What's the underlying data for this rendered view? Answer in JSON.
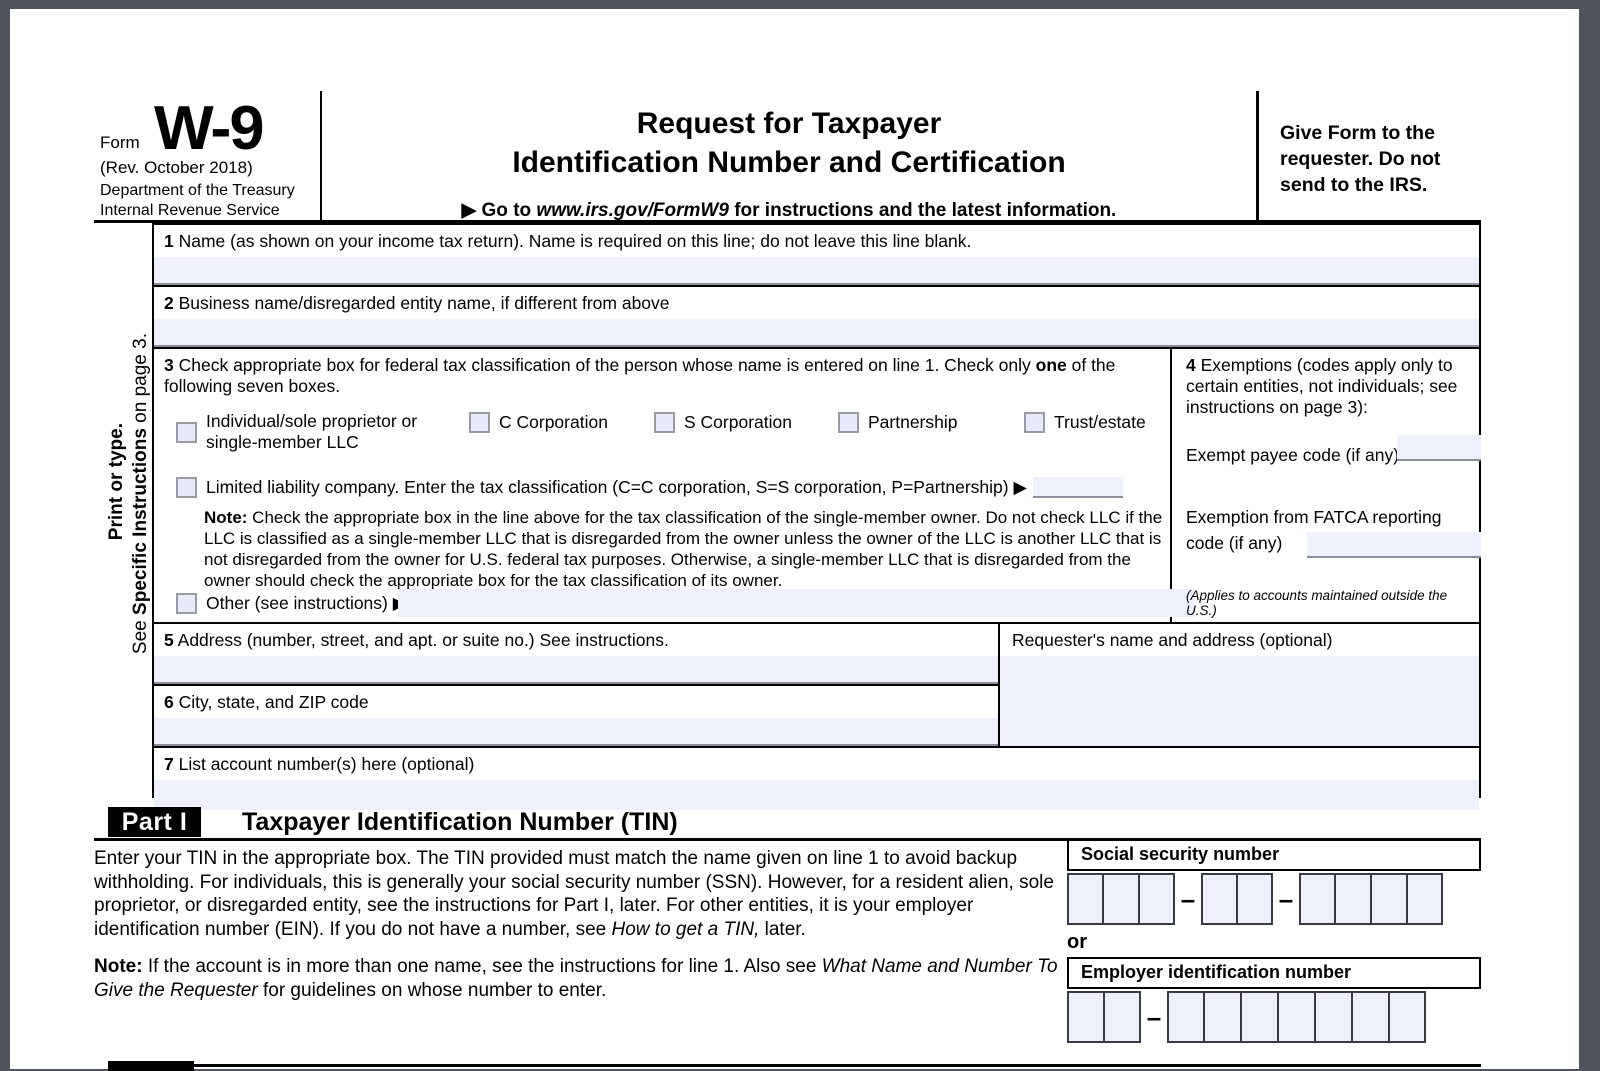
{
  "form": {
    "form_word": "Form",
    "form_number": "W-9",
    "revision": "(Rev. October 2018)",
    "department_line1": "Department of the Treasury",
    "department_line2": "Internal Revenue Service",
    "title_line1": "Request for Taxpayer",
    "title_line2": "Identification Number and Certification",
    "goto_prefix": "▶ Go to ",
    "goto_url": "www.irs.gov/FormW9",
    "goto_suffix": " for instructions and the latest information.",
    "give_form_line1": "Give Form to the",
    "give_form_line2": "requester. Do not",
    "give_form_line3": "send to the IRS."
  },
  "sidebar": {
    "print_or_type": "Print or type.",
    "see_instructions_prefix": "See ",
    "see_instructions_bold": "Specific Instructions",
    "see_instructions_suffix": " on page 3."
  },
  "line1": {
    "number": "1",
    "label": "Name (as shown on your income tax return). Name is required on this line; do not leave this line blank.",
    "value": ""
  },
  "line2": {
    "number": "2",
    "label": "Business name/disregarded entity name, if different from above",
    "value": ""
  },
  "line3": {
    "number": "3",
    "label_part1": "Check appropriate box for federal tax classification of the person whose name is entered on line 1. Check only ",
    "label_bold": "one",
    "label_part2": " of the following seven boxes.",
    "checkboxes": [
      {
        "id": "individual",
        "label_line1": "Individual/sole proprietor or",
        "label_line2": "single-member LLC",
        "checked": false
      },
      {
        "id": "c-corporation",
        "label": "C Corporation",
        "checked": false
      },
      {
        "id": "s-corporation",
        "label": "S Corporation",
        "checked": false
      },
      {
        "id": "partnership",
        "label": "Partnership",
        "checked": false
      },
      {
        "id": "trust-estate",
        "label": "Trust/estate",
        "checked": false
      }
    ],
    "llc": {
      "label": "Limited liability company. Enter the tax classification (C=C corporation, S=S corporation, P=Partnership) ▶",
      "value": "",
      "checked": false
    },
    "note_bold": "Note:",
    "note_text": " Check the appropriate box in the line above for the tax classification of the single-member owner.  Do not check LLC if the LLC is classified as a single-member LLC that is disregarded from the owner unless the owner of the LLC is another LLC that is not disregarded from the owner for U.S. federal tax purposes. Otherwise, a single-member LLC that is disregarded from the owner should check the appropriate box for the tax classification of its owner.",
    "other": {
      "label": "Other (see instructions) ▶",
      "value": "",
      "checked": false
    }
  },
  "line4": {
    "number": "4",
    "label": "Exemptions (codes apply only to certain entities, not individuals; see instructions on page 3):",
    "exempt_payee_label": "Exempt payee code (if any)",
    "exempt_payee_value": "",
    "fatca_label_line1": "Exemption from FATCA reporting",
    "fatca_label_line2": "code (if any)",
    "fatca_value": "",
    "footnote": "(Applies to accounts maintained outside the U.S.)"
  },
  "line5": {
    "number": "5",
    "label": "Address (number, street, and apt. or suite no.) See instructions.",
    "value": ""
  },
  "line6": {
    "number": "6",
    "label": "City, state, and ZIP code",
    "value": ""
  },
  "requester": {
    "label": "Requester's name and address (optional)",
    "value": ""
  },
  "line7": {
    "number": "7",
    "label": "List account number(s) here (optional)",
    "value": ""
  },
  "part1": {
    "part_label": "Part I",
    "title": "Taxpayer Identification Number (TIN)",
    "paragraph1_a": "Enter your TIN in the appropriate box. The TIN provided must match the name given on line 1 to avoid backup withholding. For individuals, this is generally your social security number (SSN). However, for a resident alien, sole proprietor, or disregarded entity, see the instructions for Part I, later. For other entities, it is your employer identification number (EIN). If you do not have a number, see ",
    "paragraph1_italic": "How to get a TIN,",
    "paragraph1_b": " later.",
    "note_bold": "Note:",
    "note_a": " If the account is in more than one name, see the instructions for line 1. Also see ",
    "note_italic": "What Name and Number To Give the Requester",
    "note_b": " for guidelines on whose number to enter."
  },
  "tin": {
    "ssn_label": "Social security number",
    "ssn_groups": [
      3,
      2,
      4
    ],
    "ssn_value": "",
    "or_label": "or",
    "ein_label": "Employer identification number",
    "ein_groups": [
      2,
      7
    ],
    "ein_value": "",
    "separator": "–"
  },
  "colors": {
    "field_fill": "#eef0fb",
    "field_border": "#8a8d9a",
    "checkbox_fill": "#e7eafa",
    "checkbox_border": "#9a9aa2",
    "page_background": "#ffffff",
    "viewer_background": "#50545c",
    "ink": "#000000"
  }
}
